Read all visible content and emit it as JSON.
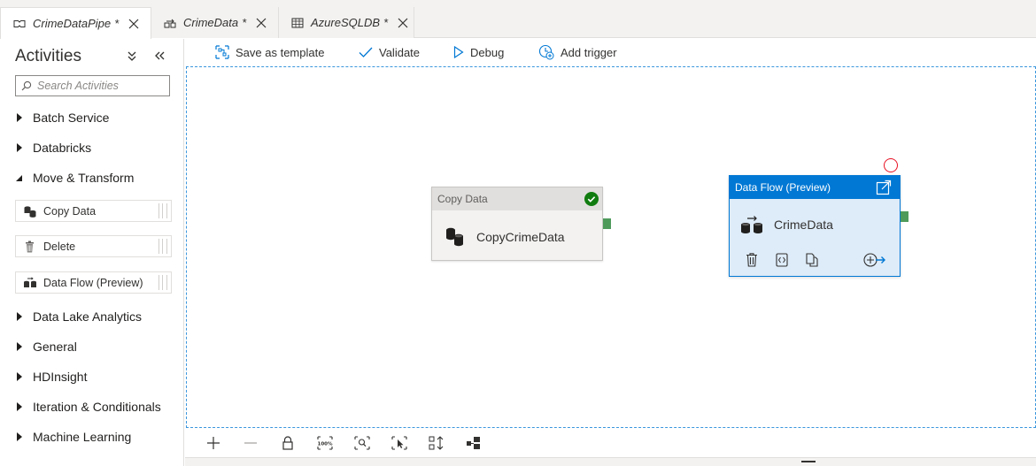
{
  "tabs": [
    {
      "label": "CrimeDataPipe",
      "modified": "*",
      "icon": "pipeline-icon"
    },
    {
      "label": "CrimeData",
      "modified": "*",
      "icon": "dataflow-icon"
    },
    {
      "label": "AzureSQLDB",
      "modified": "*",
      "icon": "table-icon"
    }
  ],
  "activities": {
    "title": "Activities",
    "search_placeholder": "Search Activities",
    "categories_top": [
      "Batch Service",
      "Databricks"
    ],
    "expanded_category": "Move & Transform",
    "items": [
      {
        "label": "Copy Data",
        "icon": "copy-data-icon"
      },
      {
        "label": "Delete",
        "icon": "trash-icon"
      },
      {
        "label": "Data Flow (Preview)",
        "icon": "dataflow-icon"
      }
    ],
    "categories_bottom": [
      "Data Lake Analytics",
      "General",
      "HDInsight",
      "Iteration & Conditionals",
      "Machine Learning"
    ]
  },
  "toolbar": {
    "save_template": "Save as template",
    "validate": "Validate",
    "debug": "Debug",
    "add_trigger": "Add trigger"
  },
  "canvas": {
    "copy_node": {
      "header": "Copy Data",
      "name": "CopyCrimeData",
      "status": "succeeded"
    },
    "flow_node": {
      "header": "Data Flow (Preview)",
      "name": "CrimeData"
    }
  },
  "colors": {
    "accent": "#0078d4",
    "node_selected_bg": "#deecf9",
    "success": "#107c10",
    "port": "#4e9a5b",
    "error": "#e81123"
  }
}
